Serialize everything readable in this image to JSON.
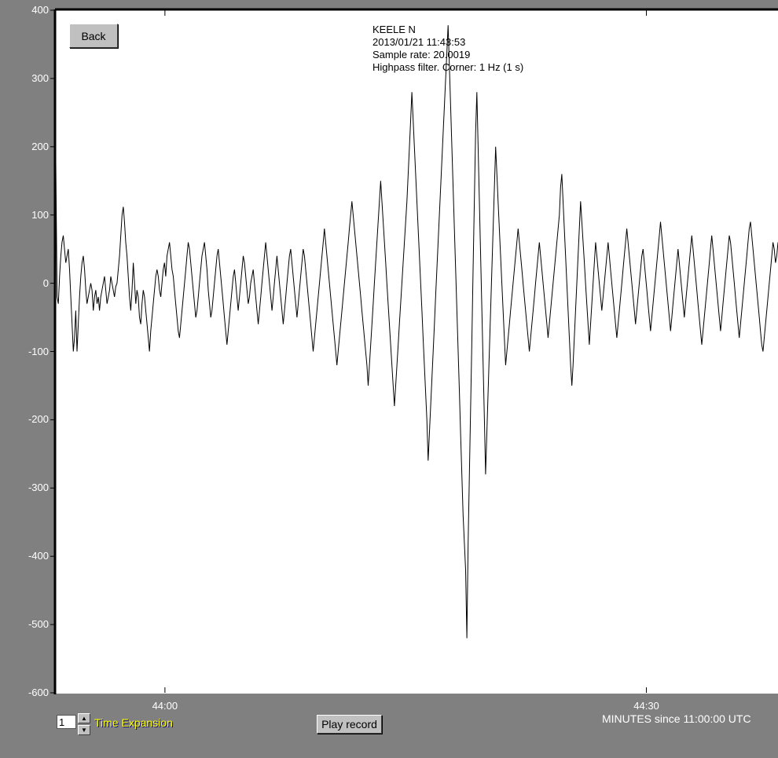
{
  "window": {
    "background": "#808080",
    "plot_background": "#ffffff",
    "trace_color": "#000000"
  },
  "header": {
    "station": "KEELE  N",
    "datetime": "2013/01/21 11:43:53",
    "sample_rate": "Sample rate: 20.0019",
    "filter": "Highpass filter. Corner: 1 Hz (1 s)"
  },
  "controls": {
    "back_label": "Back",
    "play_label": "Play record",
    "time_expansion_value": "1",
    "time_expansion_label": "Time Expansion",
    "up_icon": "triangle-up-icon",
    "down_icon": "triangle-down-icon"
  },
  "axis": {
    "x_label": "MINUTES since 11:00:00 UTC"
  },
  "chart_data": {
    "type": "line",
    "title": "",
    "xlabel": "MINUTES since 11:00:00 UTC",
    "ylabel": "",
    "xlim": [
      "11:43:53.2",
      "11:44:38.2"
    ],
    "ylim": [
      -600,
      400
    ],
    "x_ticks": [
      {
        "value": "11:44:00",
        "label": "44:00"
      },
      {
        "value": "11:44:30",
        "label": "44:30"
      }
    ],
    "y_ticks": [
      400,
      300,
      200,
      100,
      0,
      -100,
      -200,
      -300,
      -400,
      -500,
      -600
    ],
    "grid": false,
    "series": [
      {
        "sample_rate_hz": 20.0019,
        "samples_per_point": 0.5,
        "note_start": "11:43:53.2",
        "y": [
          178,
          -20,
          -30,
          10,
          40,
          60,
          70,
          50,
          30,
          40,
          50,
          20,
          -20,
          -60,
          -100,
          -80,
          -40,
          -100,
          -60,
          -20,
          10,
          30,
          40,
          20,
          -10,
          -30,
          -20,
          -10,
          0,
          -10,
          -40,
          -20,
          -10,
          -30,
          -20,
          -40,
          -20,
          -10,
          0,
          10,
          -10,
          -30,
          -20,
          -10,
          10,
          0,
          -10,
          -20,
          -5,
          0,
          20,
          40,
          70,
          100,
          112,
          90,
          60,
          40,
          10,
          -20,
          -40,
          -10,
          30,
          0,
          -30,
          -10,
          -20,
          -50,
          -60,
          -30,
          -10,
          -20,
          -40,
          -60,
          -80,
          -100,
          -70,
          -50,
          -30,
          -10,
          10,
          20,
          10,
          -10,
          -20,
          0,
          20,
          30,
          10,
          40,
          50,
          60,
          40,
          20,
          10,
          -10,
          -30,
          -50,
          -70,
          -80,
          -60,
          -40,
          -20,
          0,
          20,
          40,
          60,
          50,
          30,
          10,
          -10,
          -30,
          -50,
          -40,
          -20,
          0,
          20,
          40,
          50,
          60,
          40,
          20,
          -10,
          -30,
          -50,
          -40,
          -20,
          0,
          20,
          40,
          50,
          30,
          10,
          -10,
          -30,
          -50,
          -70,
          -90,
          -70,
          -50,
          -30,
          -10,
          10,
          20,
          0,
          -20,
          -40,
          -20,
          0,
          20,
          40,
          30,
          10,
          -10,
          -30,
          -20,
          0,
          10,
          20,
          0,
          -20,
          -40,
          -60,
          -40,
          -20,
          0,
          20,
          40,
          60,
          40,
          20,
          0,
          -20,
          -40,
          -20,
          0,
          20,
          40,
          20,
          0,
          -20,
          -40,
          -60,
          -40,
          -20,
          0,
          20,
          40,
          50,
          30,
          10,
          -10,
          -30,
          -50,
          -30,
          -10,
          10,
          30,
          50,
          40,
          20,
          0,
          -20,
          -40,
          -60,
          -80,
          -100,
          -80,
          -60,
          -40,
          -20,
          0,
          20,
          40,
          60,
          80,
          60,
          40,
          20,
          0,
          -20,
          -40,
          -60,
          -80,
          -100,
          -120,
          -100,
          -80,
          -60,
          -40,
          -20,
          0,
          20,
          40,
          60,
          80,
          100,
          120,
          100,
          80,
          60,
          40,
          20,
          0,
          -20,
          -40,
          -60,
          -80,
          -100,
          -120,
          -150,
          -120,
          -90,
          -60,
          -30,
          0,
          30,
          60,
          90,
          120,
          150,
          120,
          90,
          60,
          30,
          0,
          -30,
          -60,
          -90,
          -120,
          -150,
          -180,
          -150,
          -120,
          -90,
          -60,
          -30,
          0,
          30,
          60,
          90,
          120,
          160,
          200,
          240,
          280,
          240,
          200,
          160,
          120,
          80,
          40,
          0,
          -40,
          -80,
          -120,
          -160,
          -200,
          -260,
          -220,
          -180,
          -140,
          -100,
          -60,
          -20,
          20,
          60,
          100,
          140,
          180,
          220,
          260,
          300,
          340,
          378,
          320,
          260,
          200,
          140,
          80,
          20,
          -40,
          -100,
          -160,
          -220,
          -280,
          -340,
          -380,
          -420,
          -520,
          -380,
          -280,
          -180,
          -80,
          20,
          120,
          220,
          280,
          200,
          120,
          40,
          -40,
          -120,
          -200,
          -280,
          -220,
          -160,
          -100,
          -40,
          20,
          80,
          140,
          200,
          160,
          120,
          80,
          40,
          0,
          -40,
          -80,
          -120,
          -100,
          -80,
          -60,
          -40,
          -20,
          0,
          20,
          40,
          60,
          80,
          60,
          40,
          20,
          0,
          -20,
          -40,
          -60,
          -80,
          -100,
          -80,
          -60,
          -40,
          -20,
          0,
          20,
          40,
          60,
          40,
          20,
          0,
          -20,
          -40,
          -60,
          -80,
          -60,
          -40,
          -20,
          0,
          20,
          40,
          60,
          80,
          100,
          140,
          160,
          120,
          80,
          40,
          0,
          -40,
          -80,
          -120,
          -150,
          -120,
          -80,
          -40,
          0,
          40,
          80,
          120,
          90,
          60,
          30,
          0,
          -30,
          -60,
          -90,
          -60,
          -30,
          0,
          30,
          60,
          40,
          20,
          0,
          -20,
          -40,
          -20,
          0,
          20,
          40,
          60,
          40,
          20,
          0,
          -20,
          -40,
          -60,
          -80,
          -60,
          -40,
          -20,
          0,
          20,
          40,
          60,
          80,
          60,
          40,
          20,
          0,
          -20,
          -40,
          -60,
          -40,
          -20,
          0,
          20,
          40,
          50,
          30,
          10,
          -10,
          -30,
          -50,
          -70,
          -50,
          -30,
          -10,
          10,
          30,
          50,
          70,
          90,
          70,
          50,
          30,
          10,
          -10,
          -30,
          -50,
          -70,
          -50,
          -30,
          -10,
          10,
          30,
          50,
          30,
          10,
          -10,
          -30,
          -50,
          -30,
          -10,
          10,
          30,
          50,
          70,
          50,
          30,
          10,
          -10,
          -30,
          -50,
          -70,
          -90,
          -70,
          -50,
          -30,
          -10,
          10,
          30,
          50,
          70,
          50,
          30,
          10,
          -10,
          -30,
          -50,
          -70,
          -50,
          -30,
          -10,
          10,
          30,
          50,
          70,
          60,
          40,
          20,
          0,
          -20,
          -40,
          -60,
          -80,
          -60,
          -40,
          -20,
          0,
          20,
          40,
          60,
          80,
          90,
          70,
          50,
          30,
          10,
          -10,
          -30,
          -50,
          -70,
          -90,
          -100,
          -80,
          -60,
          -40,
          -20,
          0,
          20,
          40,
          60,
          50,
          30,
          40,
          60
        ]
      }
    ]
  }
}
